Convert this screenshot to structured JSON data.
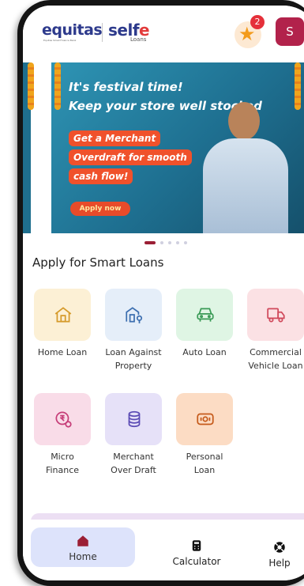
{
  "header": {
    "brand_name": "equitas",
    "brand_tagline": "Equitas Small Finance Bank",
    "app_name_prefix": "self",
    "app_name_suffix": "e",
    "app_subtitle": "Loans",
    "rewards_badge_count": "2",
    "avatar_initial": "S"
  },
  "banner": {
    "headline_line1": "It's festival time!",
    "headline_line2": "Keep your store well stocked",
    "pill_line1": "Get a Merchant",
    "pill_line2": "Overdraft for smooth",
    "pill_line3": "cash flow!",
    "cta_label": "Apply now",
    "carousel_total": 5,
    "carousel_active": 1,
    "colors": {
      "bg": "#2e94b4",
      "accent": "#f0512b"
    }
  },
  "section": {
    "title": "Apply for Smart Loans"
  },
  "loans": [
    {
      "label_line1": "Home Loan",
      "label_line2": "",
      "icon": "house-icon",
      "bg": "#fcf0d5",
      "fg": "#d59a2a"
    },
    {
      "label_line1": "Loan Against",
      "label_line2": "Property",
      "icon": "property-icon",
      "bg": "#e5eef9",
      "fg": "#3d6fb0"
    },
    {
      "label_line1": "Auto Loan",
      "label_line2": "",
      "icon": "car-icon",
      "bg": "#dff5e4",
      "fg": "#3a9a56"
    },
    {
      "label_line1": "Commercial",
      "label_line2": "Vehicle Loan",
      "icon": "truck-icon",
      "bg": "#fbe1e4",
      "fg": "#d0495b"
    },
    {
      "label_line1": "Micro",
      "label_line2": "Finance",
      "icon": "rupee-coin-icon",
      "bg": "#f9dce8",
      "fg": "#c63d78"
    },
    {
      "label_line1": "Merchant",
      "label_line2": "Over Draft",
      "icon": "coin-stack-icon",
      "bg": "#e6e1f8",
      "fg": "#5b4bb5"
    },
    {
      "label_line1": "Personal",
      "label_line2": "Loan",
      "icon": "cash-icon",
      "bg": "#fcdcc4",
      "fg": "#c55a1a"
    }
  ],
  "nav": {
    "home_label": "Home",
    "calculator_label": "Calculator",
    "help_label": "Help",
    "active_color": "#9b1f35"
  }
}
